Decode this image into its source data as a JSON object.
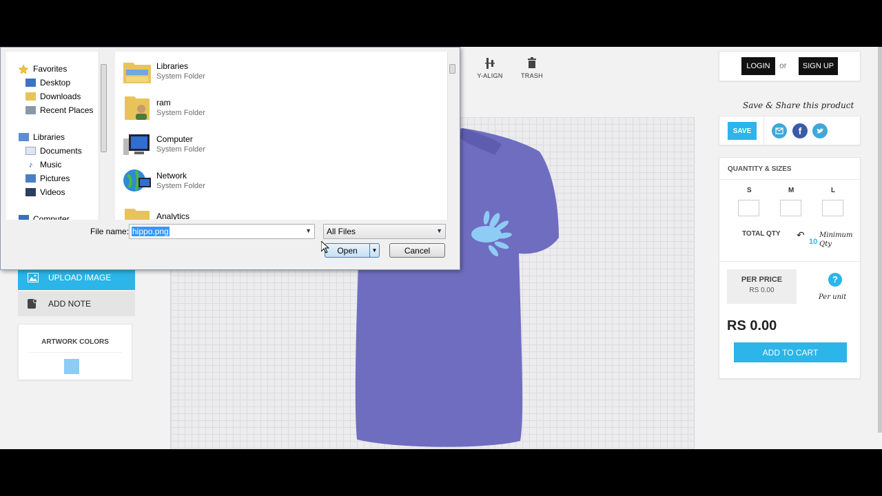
{
  "toolbar": {
    "yalign_label": "Y-ALIGN",
    "trash_label": "TRASH"
  },
  "header": {
    "login_label": "LOGIN",
    "or_text": "or",
    "signup_label": "SIGN UP"
  },
  "share": {
    "title": "Save & Share this product",
    "save_label": "SAVE"
  },
  "quantity": {
    "title": "QUANTITY & SIZES",
    "sizes": [
      "S",
      "M",
      "L"
    ],
    "total_qty_label": "TOTAL QTY",
    "min_qty_value": "10",
    "min_qty_note": "Minimum Qty"
  },
  "pricing": {
    "per_price_label": "PER PRICE",
    "per_price_value": "RS 0.00",
    "help_icon_text": "?",
    "per_unit_note": "Per unit",
    "total": "RS 0.00",
    "add_to_cart_label": "ADD TO CART"
  },
  "left_panel": {
    "upload_label": "UPLOAD IMAGE",
    "note_label": "ADD NOTE",
    "artwork_colors_title": "ARTWORK COLORS",
    "artwork_color": "#8ecbf5"
  },
  "colors": {
    "accent": "#2bb5e8",
    "shirt": "#6f6dc0",
    "print": "#8ecbf5"
  },
  "dialog": {
    "nav": {
      "favorites": {
        "label": "Favorites",
        "icon": "star-icon"
      },
      "favorite_items": [
        {
          "label": "Desktop",
          "icon": "desktop-icon"
        },
        {
          "label": "Downloads",
          "icon": "downloads-icon"
        },
        {
          "label": "Recent Places",
          "icon": "recent-places-icon"
        }
      ],
      "libraries": {
        "label": "Libraries",
        "icon": "libraries-icon"
      },
      "library_items": [
        {
          "label": "Documents",
          "icon": "documents-icon"
        },
        {
          "label": "Music",
          "icon": "music-icon"
        },
        {
          "label": "Pictures",
          "icon": "pictures-icon"
        },
        {
          "label": "Videos",
          "icon": "videos-icon"
        }
      ],
      "computer": {
        "label": "Computer",
        "icon": "computer-icon"
      }
    },
    "files": [
      {
        "name": "Libraries",
        "type": "System Folder",
        "icon": "libraries-folder-icon"
      },
      {
        "name": "ram",
        "type": "System Folder",
        "icon": "user-folder-icon"
      },
      {
        "name": "Computer",
        "type": "System Folder",
        "icon": "computer-icon"
      },
      {
        "name": "Network",
        "type": "System Folder",
        "icon": "network-icon"
      },
      {
        "name": "Analytics",
        "type": "",
        "icon": "folder-icon"
      }
    ],
    "file_name_label": "File name:",
    "file_name_value": "hippo.png",
    "filter_value": "All Files",
    "open_label": "Open",
    "cancel_label": "Cancel"
  }
}
